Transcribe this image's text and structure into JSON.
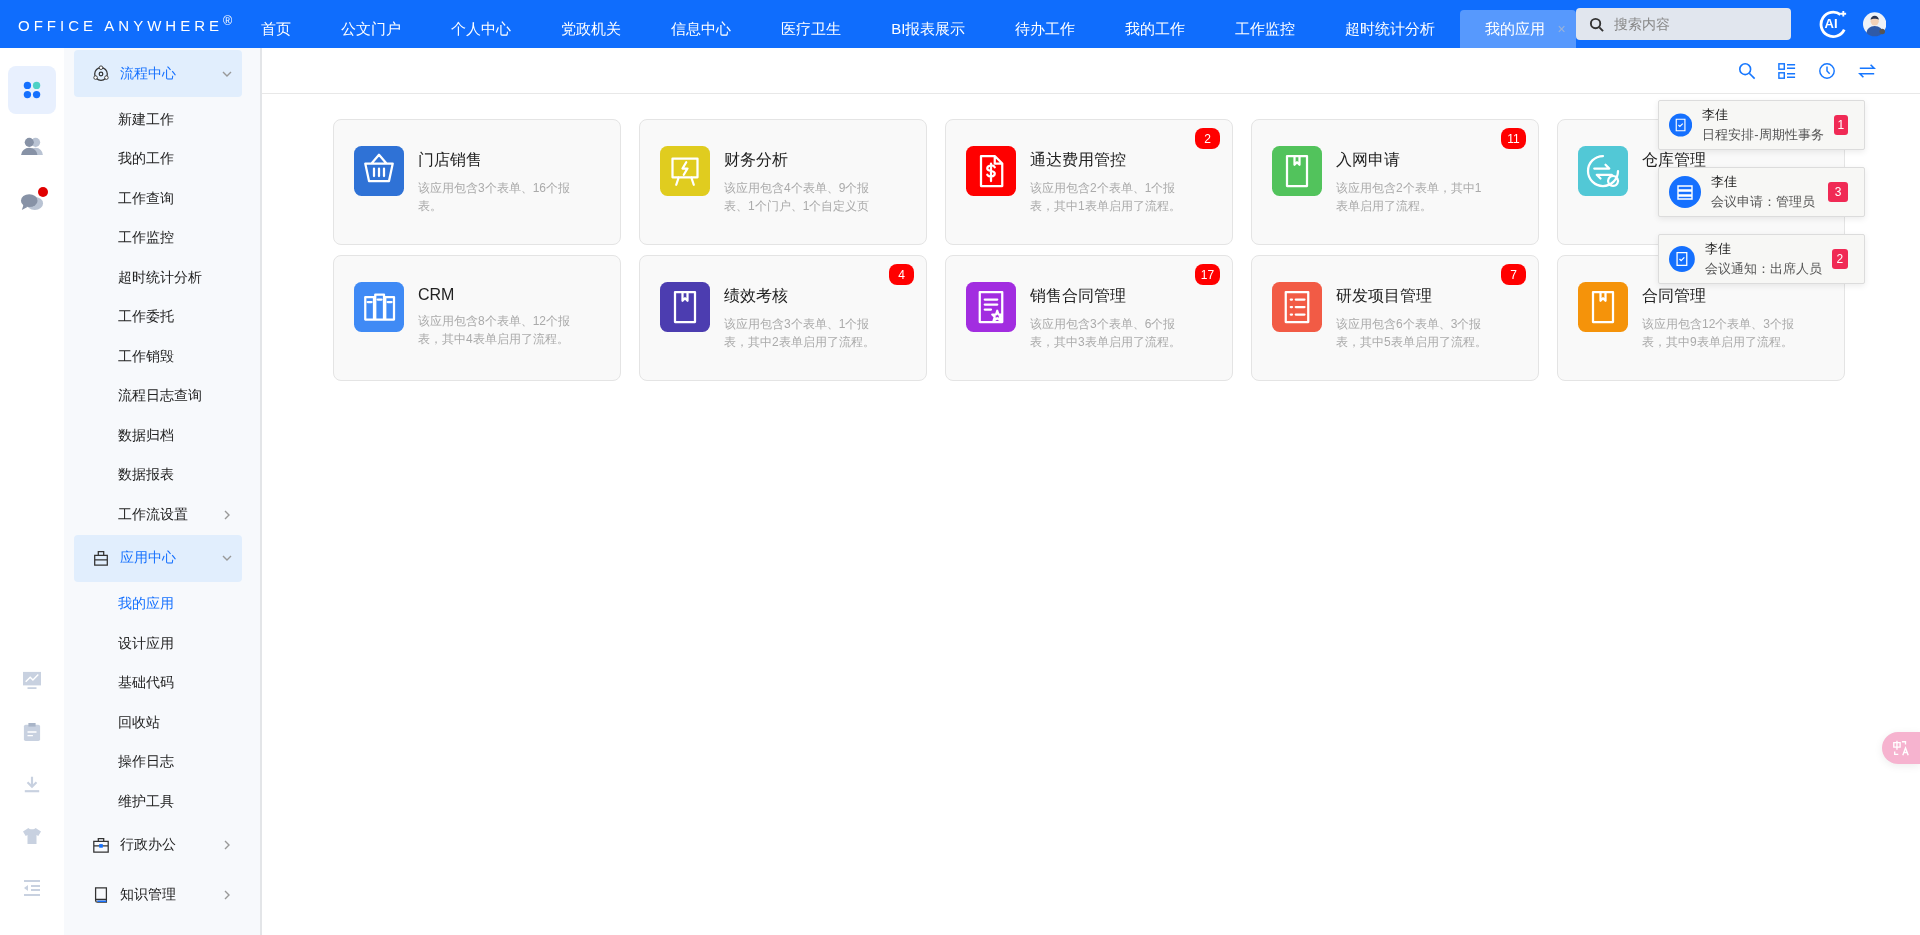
{
  "header": {
    "logo": "OFFICE ANYWHERE$^{®}$",
    "search": {
      "placeholder": "搜索内容"
    },
    "ai_button": "AI"
  },
  "nav": [
    {
      "label": "首页",
      "selected": false
    },
    {
      "label": "公文门户",
      "selected": false
    },
    {
      "label": "个人中心",
      "selected": false
    },
    {
      "label": "党政机关",
      "selected": false
    },
    {
      "label": "信息中心",
      "selected": false
    },
    {
      "label": "医疗卫生",
      "selected": false
    },
    {
      "label": "BI报表展示",
      "selected": false
    },
    {
      "label": "待办工作",
      "selected": false
    },
    {
      "label": "我的工作",
      "selected": false
    },
    {
      "label": "工作监控",
      "selected": false
    },
    {
      "label": "超时统计分析",
      "selected": false
    },
    {
      "label": "我的应用",
      "selected": true,
      "close": "×"
    }
  ],
  "rail": {
    "top": [
      {
        "selected": true,
        "unread": false
      },
      {
        "selected": false,
        "unread": false
      },
      {
        "selected": false,
        "unread": true
      }
    ],
    "bottom": [
      {
        "selected": false
      },
      {
        "selected": false
      },
      {
        "selected": false
      },
      {
        "selected": false
      },
      {
        "selected": false
      }
    ]
  },
  "sidebar": [
    {
      "label": "流程中心",
      "expanded": true,
      "children": [
        {
          "label": "新建工作",
          "selected": false,
          "has_submenu": false
        },
        {
          "label": "我的工作",
          "selected": false,
          "has_submenu": false
        },
        {
          "label": "工作查询",
          "selected": false,
          "has_submenu": false
        },
        {
          "label": "工作监控",
          "selected": false,
          "has_submenu": false
        },
        {
          "label": "超时统计分析",
          "selected": false,
          "has_submenu": false
        },
        {
          "label": "工作委托",
          "selected": false,
          "has_submenu": false
        },
        {
          "label": "工作销毁",
          "selected": false,
          "has_submenu": false
        },
        {
          "label": "流程日志查询",
          "selected": false,
          "has_submenu": false
        },
        {
          "label": "数据归档",
          "selected": false,
          "has_submenu": false
        },
        {
          "label": "数据报表",
          "selected": false,
          "has_submenu": false
        },
        {
          "label": "工作流设置",
          "selected": false,
          "has_submenu": true
        }
      ]
    },
    {
      "label": "应用中心",
      "expanded": true,
      "children": [
        {
          "label": "我的应用",
          "selected": true,
          "has_submenu": false
        },
        {
          "label": "设计应用",
          "selected": false,
          "has_submenu": false
        },
        {
          "label": "基础代码",
          "selected": false,
          "has_submenu": false
        },
        {
          "label": "回收站",
          "selected": false,
          "has_submenu": false
        },
        {
          "label": "操作日志",
          "selected": false,
          "has_submenu": false
        },
        {
          "label": "维护工具",
          "selected": false,
          "has_submenu": false
        }
      ]
    },
    {
      "label": "行政办公",
      "expanded": false
    },
    {
      "label": "知识管理",
      "expanded": false
    }
  ],
  "apps": [
    {
      "title": "门店销售",
      "description": "该应用包含3个表单、16个报表。",
      "color": "#2f72d6"
    },
    {
      "title": "财务分析",
      "description": "该应用包含4个表单、9个报表、1个门户、1个自定义页",
      "color": "#e0cc1f"
    },
    {
      "title": "通达费用管控",
      "description": "该应用包含2个表单、1个报表，其中1表单启用了流程。",
      "badge": "2",
      "color": "#ff0000"
    },
    {
      "title": "入网申请",
      "description": "该应用包含2个表单，其中1表单启用了流程。",
      "badge": "11",
      "color": "#52c35c"
    },
    {
      "title": "仓库管理",
      "color": "#52c8d6"
    },
    {
      "title": "CRM",
      "description": "该应用包含8个表单、12个报表，其中4表单启用了流程。",
      "color": "#3f8af5"
    },
    {
      "title": "绩效考核",
      "description": "该应用包含3个表单、1个报表，其中2表单启用了流程。",
      "badge": "4",
      "color": "#4c3db0"
    },
    {
      "title": "销售合同管理",
      "description": "该应用包含3个表单、6个报表，其中3表单启用了流程。",
      "badge": "17",
      "color": "#a22de0"
    },
    {
      "title": "研发项目管理",
      "description": "该应用包含6个表单、3个报表，其中5表单启用了流程。",
      "badge": "7",
      "color": "#f25b45"
    },
    {
      "title": "合同管理",
      "description": "该应用包含12个表单、3个报表，其中9表单启用了流程。",
      "color": "#f5930a"
    }
  ],
  "notifications": [
    {
      "name": "李佳",
      "text": "日程安排-周期性事务",
      "count": "1"
    },
    {
      "name": "李佳",
      "text": "会议申请：管理员",
      "count": "3"
    },
    {
      "name": "李佳",
      "text": "会议通知：出席人员",
      "count": "2"
    }
  ]
}
